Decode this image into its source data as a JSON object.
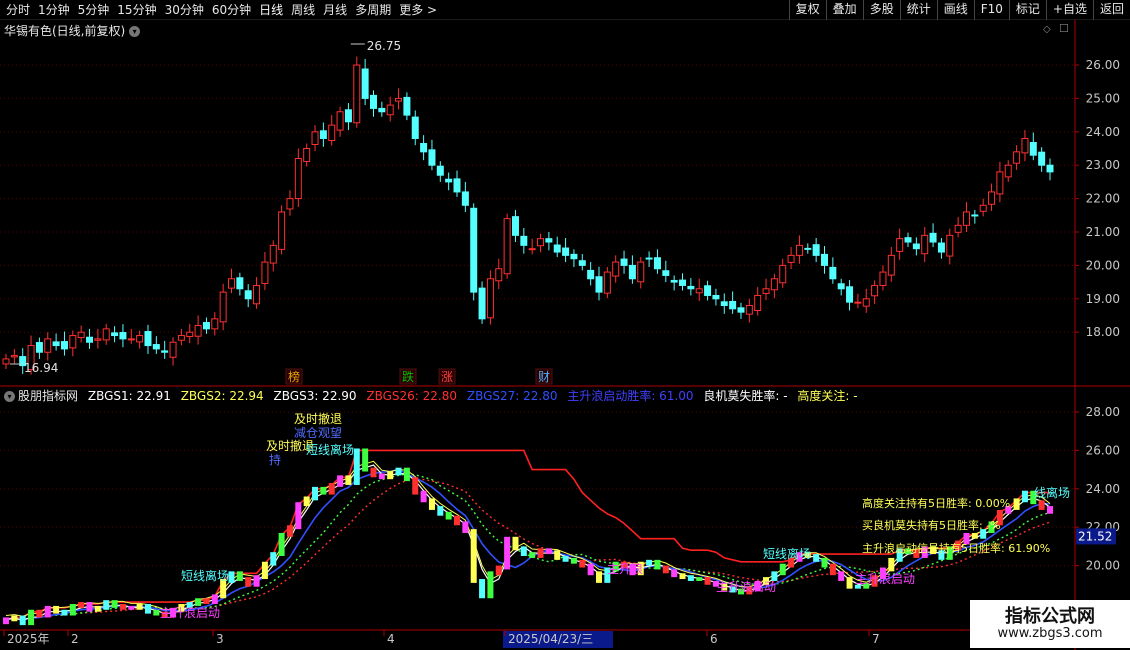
{
  "toolbar": {
    "periods": [
      "分时",
      "1分钟",
      "5分钟",
      "15分钟",
      "30分钟",
      "60分钟",
      "日线",
      "周线",
      "月线",
      "多周期",
      "更多 >"
    ],
    "active_period": "日线",
    "actions": [
      "复权",
      "叠加",
      "多股",
      "统计",
      "画线",
      "F10",
      "标记",
      "+自选",
      "返回"
    ]
  },
  "main_chart": {
    "title": "华锡有色(日线,前复权)",
    "high_label": "26.75",
    "low_label": "16.94",
    "y_ticks": [
      "26.00",
      "25.00",
      "24.00",
      "23.00",
      "22.00",
      "21.00",
      "20.00",
      "19.00",
      "18.00"
    ],
    "markers": [
      {
        "text": "榜",
        "color": "#e8a000"
      },
      {
        "text": "跌",
        "color": "#00c000"
      },
      {
        "text": "涨",
        "color": "#ff4040"
      },
      {
        "text": "财",
        "color": "#4fb0ff"
      }
    ],
    "colors": {
      "up": "#ff3030",
      "down": "#54ffff"
    }
  },
  "indicator": {
    "name": "股朋指标网",
    "values": [
      {
        "label": "ZBGS1: 22.91",
        "color": "#ffffff"
      },
      {
        "label": "ZBGS2: 22.94",
        "color": "#ffff55"
      },
      {
        "label": "ZBGS3: 22.90",
        "color": "#ffffff"
      },
      {
        "label": "ZBGS26: 22.80",
        "color": "#ff3030"
      },
      {
        "label": "ZBGS27: 22.80",
        "color": "#3050ff"
      },
      {
        "label": "主升浪启动胜率: 61.00",
        "color": "#4040ff"
      },
      {
        "label": "良机莫失胜率: -",
        "color": "#ffffff"
      },
      {
        "label": "高度关注: -",
        "color": "#ffff55"
      }
    ],
    "y_ticks": [
      "28.00",
      "26.00",
      "24.00",
      "22.00",
      "20.00"
    ],
    "current_value": "21.52",
    "annotations": [
      {
        "text": "及时撤退",
        "color": "#ffff55"
      },
      {
        "text": "及时撤退",
        "color": "#ffff55"
      },
      {
        "text": "减仓观望",
        "color": "#4f6bff"
      },
      {
        "text": "持",
        "color": "#4f6bff"
      },
      {
        "text": "短线离场",
        "color": "#54ffff"
      },
      {
        "text": "短线离场",
        "color": "#54ffff"
      },
      {
        "text": "短线离场",
        "color": "#54ffff"
      },
      {
        "text": "线离场",
        "color": "#54ffff"
      },
      {
        "text": "主升浪启动",
        "color": "#ff40ff"
      },
      {
        "text": "主升浪启动",
        "color": "#ff40ff"
      },
      {
        "text": "主升浪启动",
        "color": "#ff40ff"
      },
      {
        "text": "主升浪",
        "color": "#ff40ff"
      }
    ],
    "stats": [
      {
        "text": "高度关注持有5日胜率: 0.00%",
        "color": "#ffff55"
      },
      {
        "text": "买良机莫失持有5日胜率: -%",
        "color": "#ffff55"
      },
      {
        "text": "主升浪启动信号持有5日胜率: 61.90%",
        "color": "#ffff55"
      }
    ]
  },
  "x_axis": {
    "labels": [
      "2025年",
      "2",
      "3",
      "4",
      "2025/04/23/三",
      "6",
      "7"
    ]
  },
  "watermark": {
    "title": "指标公式网",
    "url": "www.zbgs3.com"
  }
}
